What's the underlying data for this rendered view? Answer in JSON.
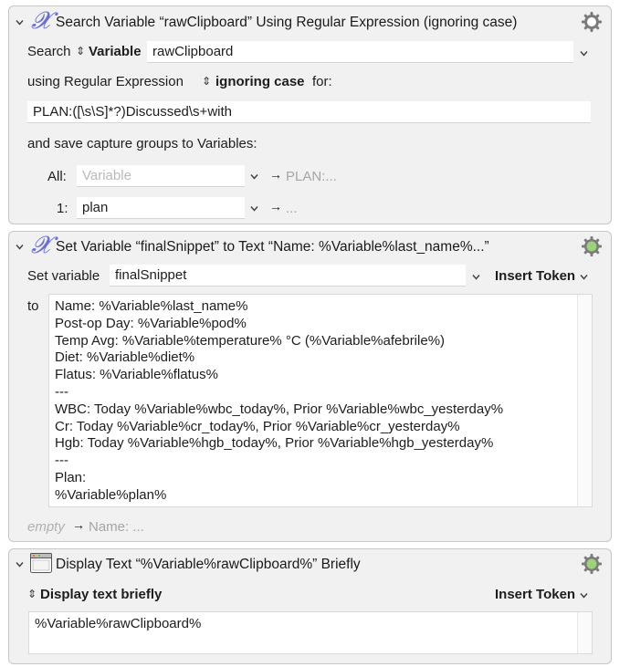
{
  "action1": {
    "title": "Search Variable “rawClipboard” Using Regular Expression (ignoring case)",
    "search_label": "Search",
    "source_type": "Variable",
    "variable_value": "rawClipboard",
    "using_label": "using Regular Expression",
    "case_option": "ignoring case",
    "for_label": "for:",
    "regex_value": "PLAN:([\\s\\S]*?)Discussed\\s+with",
    "save_label": "and save capture groups to Variables:",
    "all_label": "All:",
    "all_placeholder": "Variable",
    "all_preview": "PLAN:...",
    "group1_label": "1:",
    "group1_value": "plan",
    "group1_preview": "..."
  },
  "action2": {
    "title": "Set Variable “finalSnippet” to Text “Name: %Variable%last_name%...”",
    "set_label": "Set variable",
    "variable_value": "finalSnippet",
    "insert_token": "Insert Token",
    "to_label": "to",
    "text_lines": [
      "Name: %Variable%last_name%",
      "Post-op Day: %Variable%pod%",
      "Temp Avg: %Variable%temperature% °C (%Variable%afebrile%)",
      "Diet: %Variable%diet%",
      "Flatus: %Variable%flatus%",
      "---",
      "WBC: Today %Variable%wbc_today%, Prior %Variable%wbc_yesterday%",
      "Cr: Today %Variable%cr_today%, Prior %Variable%cr_yesterday%",
      "Hgb: Today %Variable%hgb_today%, Prior %Variable%hgb_yesterday%",
      "---",
      "Plan:",
      "%Variable%plan%"
    ],
    "preview_empty": "empty",
    "preview_text": "Name: ..."
  },
  "action3": {
    "title": "Display Text “%Variable%rawClipboard%” Briefly",
    "mode": "Display text briefly",
    "insert_token": "Insert Token",
    "text_value": "%Variable%rawClipboard%"
  },
  "colors": {
    "panel_bg": "#f1f1f1",
    "gear_enabled_dot": "#9bd27a",
    "variable_icon": "#6b6fd6"
  },
  "icons": [
    "disclosure-chevron-icon",
    "variable-x-icon",
    "gear-icon",
    "window-icon",
    "popup-chevron-icon",
    "updown-arrows-icon",
    "right-arrow-icon"
  ]
}
